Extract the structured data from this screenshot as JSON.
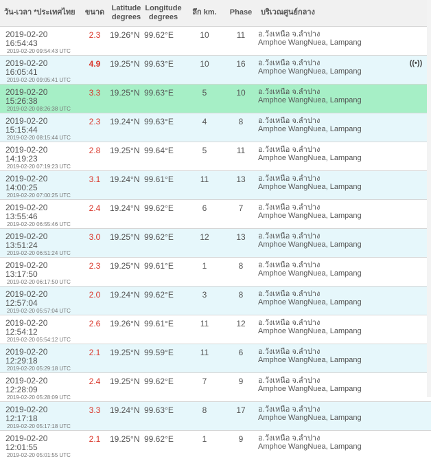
{
  "header": {
    "datetime": "วัน-เวลา *ประเทศไทย",
    "magnitude": "ขนาด",
    "latitude": "Latitude degrees",
    "longitude": "Longitude degrees",
    "depth": "ลึก km.",
    "phase": "Phase",
    "location": "บริเวณศูนย์กลาง"
  },
  "rows": [
    {
      "local": "2019-02-20 16:54:43",
      "utc": "2019-02-20 09:54:43 UTC",
      "mag": "2.3",
      "lat": "19.26°N",
      "lon": "99.62°E",
      "depth": "10",
      "phase": "11",
      "loc_th": "อ.วังเหนือ จ.ลำปาง",
      "loc_en": "Amphoe WangNuea, Lampang",
      "icon": ""
    },
    {
      "local": "2019-02-20 16:05:41",
      "utc": "2019-02-20 09:05:41 UTC",
      "mag": "4.9",
      "lat": "19.25°N",
      "lon": "99.63°E",
      "depth": "10",
      "phase": "16",
      "loc_th": "อ.วังเหนือ จ.ลำปาง",
      "loc_en": "Amphoe WangNuea, Lampang",
      "icon": "((•))"
    },
    {
      "local": "2019-02-20 15:26:38",
      "utc": "2019-02-20 08:26:38 UTC",
      "mag": "3.3",
      "lat": "19.25°N",
      "lon": "99.63°E",
      "depth": "5",
      "phase": "10",
      "loc_th": "อ.วังเหนือ จ.ลำปาง",
      "loc_en": "Amphoe WangNuea, Lampang",
      "icon": ""
    },
    {
      "local": "2019-02-20 15:15:44",
      "utc": "2019-02-20 08:15:44 UTC",
      "mag": "2.3",
      "lat": "19.24°N",
      "lon": "99.63°E",
      "depth": "4",
      "phase": "8",
      "loc_th": "อ.วังเหนือ จ.ลำปาง",
      "loc_en": "Amphoe WangNuea, Lampang",
      "icon": ""
    },
    {
      "local": "2019-02-20 14:19:23",
      "utc": "2019-02-20 07:19:23 UTC",
      "mag": "2.8",
      "lat": "19.25°N",
      "lon": "99.64°E",
      "depth": "5",
      "phase": "11",
      "loc_th": "อ.วังเหนือ จ.ลำปาง",
      "loc_en": "Amphoe WangNuea, Lampang",
      "icon": ""
    },
    {
      "local": "2019-02-20 14:00:25",
      "utc": "2019-02-20 07:00:25 UTC",
      "mag": "3.1",
      "lat": "19.24°N",
      "lon": "99.61°E",
      "depth": "11",
      "phase": "13",
      "loc_th": "อ.วังเหนือ จ.ลำปาง",
      "loc_en": "Amphoe WangNuea, Lampang",
      "icon": ""
    },
    {
      "local": "2019-02-20 13:55:46",
      "utc": "2019-02-20 06:55:46 UTC",
      "mag": "2.4",
      "lat": "19.24°N",
      "lon": "99.62°E",
      "depth": "6",
      "phase": "7",
      "loc_th": "อ.วังเหนือ จ.ลำปาง",
      "loc_en": "Amphoe WangNuea, Lampang",
      "icon": ""
    },
    {
      "local": "2019-02-20 13:51:24",
      "utc": "2019-02-20 06:51:24 UTC",
      "mag": "3.0",
      "lat": "19.25°N",
      "lon": "99.62°E",
      "depth": "12",
      "phase": "13",
      "loc_th": "อ.วังเหนือ จ.ลำปาง",
      "loc_en": "Amphoe WangNuea, Lampang",
      "icon": ""
    },
    {
      "local": "2019-02-20 13:17:50",
      "utc": "2019-02-20 06:17:50 UTC",
      "mag": "2.3",
      "lat": "19.25°N",
      "lon": "99.61°E",
      "depth": "1",
      "phase": "8",
      "loc_th": "อ.วังเหนือ จ.ลำปาง",
      "loc_en": "Amphoe WangNuea, Lampang",
      "icon": ""
    },
    {
      "local": "2019-02-20 12:57:04",
      "utc": "2019-02-20 05:57:04 UTC",
      "mag": "2.0",
      "lat": "19.24°N",
      "lon": "99.62°E",
      "depth": "3",
      "phase": "8",
      "loc_th": "อ.วังเหนือ จ.ลำปาง",
      "loc_en": "Amphoe WangNuea, Lampang",
      "icon": ""
    },
    {
      "local": "2019-02-20 12:54:12",
      "utc": "2019-02-20 05:54:12 UTC",
      "mag": "2.6",
      "lat": "19.26°N",
      "lon": "99.61°E",
      "depth": "11",
      "phase": "12",
      "loc_th": "อ.วังเหนือ จ.ลำปาง",
      "loc_en": "Amphoe WangNuea, Lampang",
      "icon": ""
    },
    {
      "local": "2019-02-20 12:29:18",
      "utc": "2019-02-20 05:29:18 UTC",
      "mag": "2.1",
      "lat": "19.25°N",
      "lon": "99.59°E",
      "depth": "11",
      "phase": "6",
      "loc_th": "อ.วังเหนือ จ.ลำปาง",
      "loc_en": "Amphoe WangNuea, Lampang",
      "icon": ""
    },
    {
      "local": "2019-02-20 12:28:09",
      "utc": "2019-02-20 05:28:09 UTC",
      "mag": "2.4",
      "lat": "19.25°N",
      "lon": "99.62°E",
      "depth": "7",
      "phase": "9",
      "loc_th": "อ.วังเหนือ จ.ลำปาง",
      "loc_en": "Amphoe WangNuea, Lampang",
      "icon": ""
    },
    {
      "local": "2019-02-20 12:17:18",
      "utc": "2019-02-20 05:17:18 UTC",
      "mag": "3.3",
      "lat": "19.24°N",
      "lon": "99.63°E",
      "depth": "8",
      "phase": "17",
      "loc_th": "อ.วังเหนือ จ.ลำปาง",
      "loc_en": "Amphoe WangNuea, Lampang",
      "icon": ""
    },
    {
      "local": "2019-02-20 12:01:55",
      "utc": "2019-02-20 05:01:55 UTC",
      "mag": "2.1",
      "lat": "19.25°N",
      "lon": "99.62°E",
      "depth": "1",
      "phase": "9",
      "loc_th": "อ.วังเหนือ จ.ลำปาง",
      "loc_en": "Amphoe WangNuea, Lampang",
      "icon": ""
    }
  ],
  "colors": {
    "header_bg": "#f1f1f1",
    "row_alt_bg": "#e6f7fb",
    "row_selected_bg": "#a6efc6",
    "magnitude_text": "#d9362a"
  }
}
